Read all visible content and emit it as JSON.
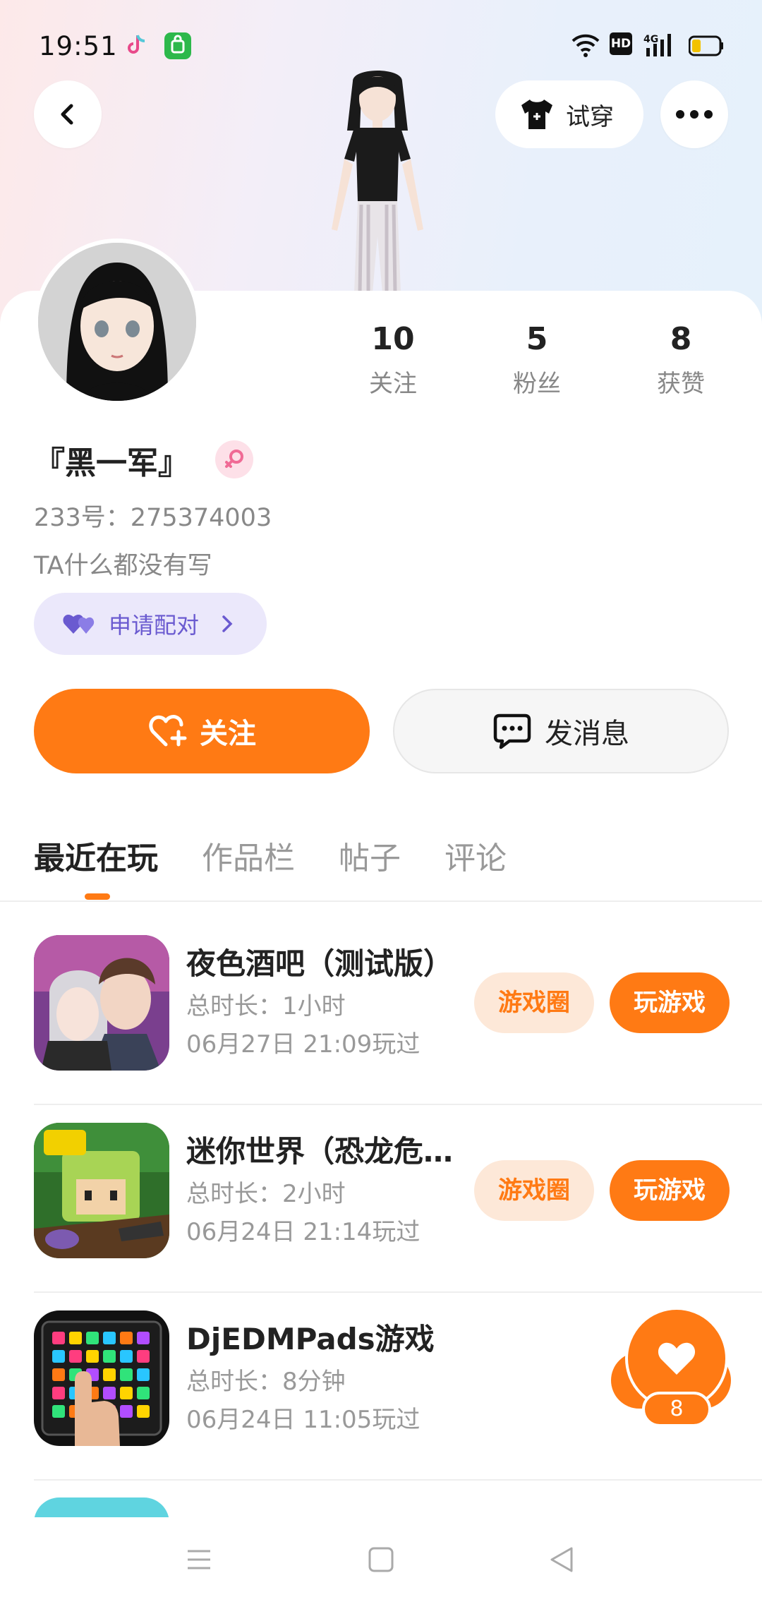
{
  "status_bar": {
    "time": "19:51",
    "hd": "HD",
    "network": "4G"
  },
  "header": {
    "tryon_label": "试穿"
  },
  "profile": {
    "name": "『黑一军』",
    "uid": "233号：275374003",
    "bio": "TA什么都没有写",
    "pair_label": "申请配对",
    "stats": [
      {
        "value": "10",
        "label": "关注"
      },
      {
        "value": "5",
        "label": "粉丝"
      },
      {
        "value": "8",
        "label": "获赞"
      }
    ]
  },
  "actions": {
    "follow_label": "关注",
    "message_label": "发消息"
  },
  "tabs": [
    "最近在玩",
    "作品栏",
    "帖子",
    "评论"
  ],
  "games": [
    {
      "title": "夜色酒吧（测试版）",
      "duration": "总时长：1小时",
      "last_played": "06月27日 21:09玩过",
      "circle_label": "游戏圈",
      "play_label": "玩游戏"
    },
    {
      "title": "迷你世界（恐龙危…",
      "duration": "总时长：2小时",
      "last_played": "06月24日 21:14玩过",
      "circle_label": "游戏圈",
      "play_label": "玩游戏"
    },
    {
      "title": "DjEDMPads游戏",
      "duration": "总时长：8分钟",
      "last_played": "06月24日 11:05玩过"
    }
  ],
  "like_fab": {
    "count": "8"
  },
  "colors": {
    "accent": "#ff7a14",
    "pair_purple": "#6a5ad0"
  }
}
